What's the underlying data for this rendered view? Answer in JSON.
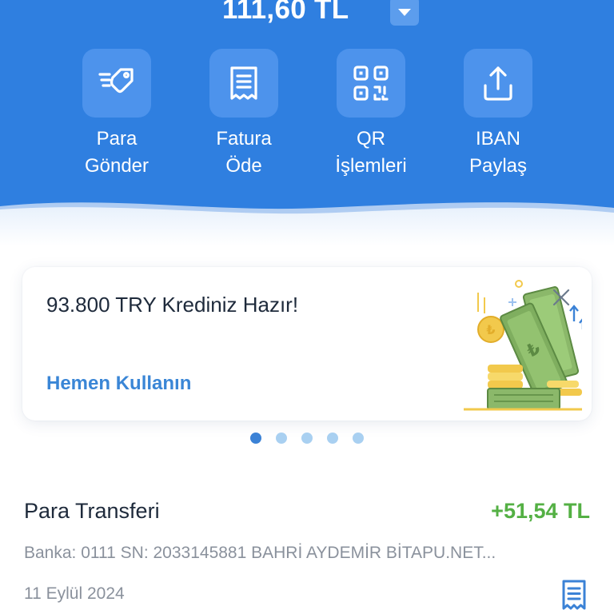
{
  "balance": {
    "amount": "111,60 TL",
    "toggle_icon": "chevron-down-icon"
  },
  "actions": [
    {
      "label_1": "Para",
      "label_2": "Gönder",
      "icon": "send-money-icon"
    },
    {
      "label_1": "Fatura",
      "label_2": "Öde",
      "icon": "bill-icon"
    },
    {
      "label_1": "QR",
      "label_2": "İşlemleri",
      "icon": "qr-code-icon"
    },
    {
      "label_1": "IBAN",
      "label_2": "Paylaş",
      "icon": "share-icon"
    }
  ],
  "promo": {
    "title": "93.800 TRY Krediniz Hazır!",
    "link": "Hemen Kullanın",
    "illustration": "money-stack-illustration",
    "close_icon": "close-icon"
  },
  "carousel": {
    "count": 5,
    "active_index": 0
  },
  "transaction": {
    "title": "Para Transferi",
    "amount": "+51,54 TL",
    "description": "Banka: 0111 SN: 2033145881 BAHRİ AYDEMİR BİTAPU.NET...",
    "date": "11 Eylül 2024",
    "receipt_icon": "receipt-icon"
  },
  "colors": {
    "header_blue": "#2f7fe0",
    "tile_blue": "#4d93ec",
    "link_blue": "#3a86d6",
    "positive_green": "#54b044",
    "muted_text": "#8a919c"
  }
}
